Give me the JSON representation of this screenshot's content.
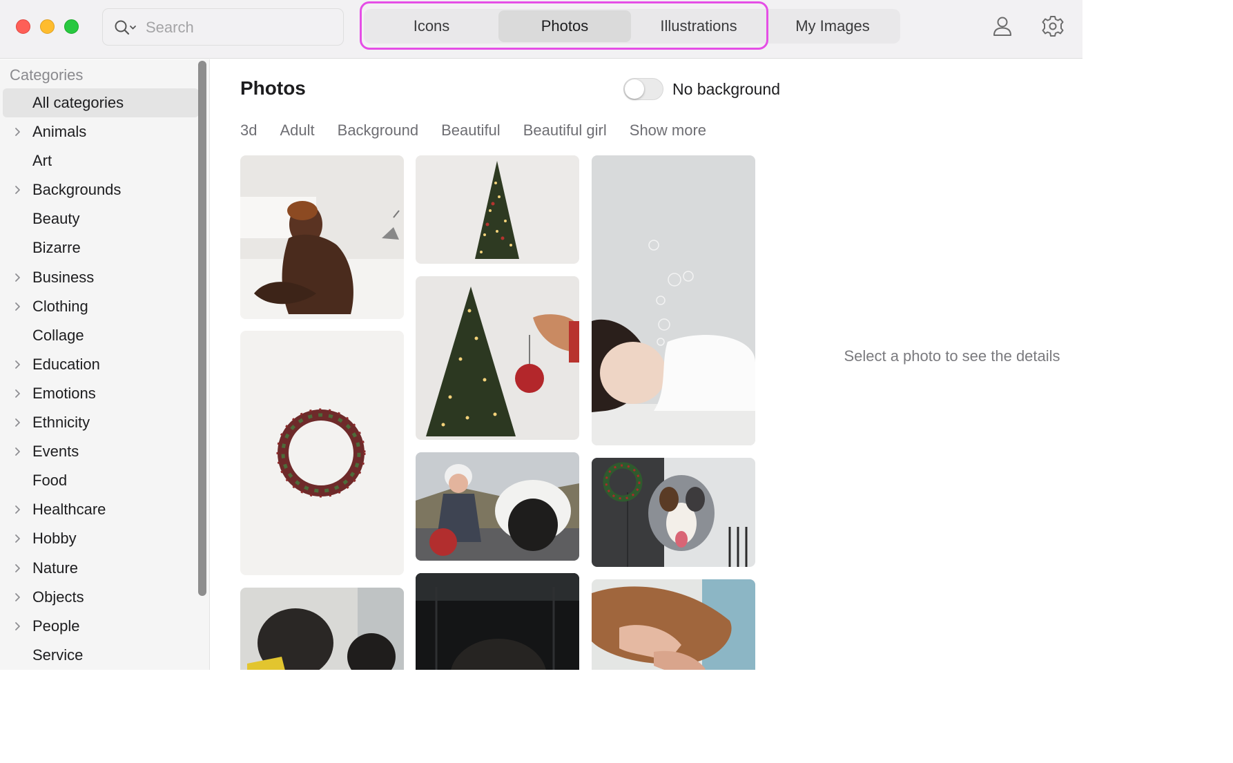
{
  "window": {
    "traffic_lights": [
      "close",
      "minimize",
      "zoom"
    ],
    "colors": {
      "close": "#fe5f57",
      "minimize": "#febc2e",
      "zoom": "#28c840",
      "highlight": "#e54ee6"
    }
  },
  "search": {
    "placeholder": "Search"
  },
  "tabs": [
    {
      "label": "Icons",
      "active": false
    },
    {
      "label": "Photos",
      "active": true
    },
    {
      "label": "Illustrations",
      "active": false
    },
    {
      "label": "My Images",
      "active": false
    }
  ],
  "toolbar_icons": [
    "person-icon",
    "gear-icon"
  ],
  "sidebar": {
    "title": "Categories",
    "items": [
      {
        "label": "All categories",
        "expandable": false,
        "selected": true
      },
      {
        "label": "Animals",
        "expandable": true
      },
      {
        "label": "Art",
        "expandable": false
      },
      {
        "label": "Backgrounds",
        "expandable": true
      },
      {
        "label": "Beauty",
        "expandable": false
      },
      {
        "label": "Bizarre",
        "expandable": false
      },
      {
        "label": "Business",
        "expandable": true
      },
      {
        "label": "Clothing",
        "expandable": true
      },
      {
        "label": "Collage",
        "expandable": false
      },
      {
        "label": "Education",
        "expandable": true
      },
      {
        "label": "Emotions",
        "expandable": true
      },
      {
        "label": "Ethnicity",
        "expandable": true
      },
      {
        "label": "Events",
        "expandable": true
      },
      {
        "label": "Food",
        "expandable": false
      },
      {
        "label": "Healthcare",
        "expandable": true
      },
      {
        "label": "Hobby",
        "expandable": true
      },
      {
        "label": "Nature",
        "expandable": true
      },
      {
        "label": "Objects",
        "expandable": true
      },
      {
        "label": "People",
        "expandable": true
      },
      {
        "label": "Service",
        "expandable": false
      }
    ]
  },
  "main": {
    "title": "Photos",
    "toggle": {
      "label": "No background",
      "on": false
    },
    "tags": [
      "3d",
      "Adult",
      "Background",
      "Beautiful",
      "Beautiful girl",
      "Show more"
    ],
    "photos": [
      "man-sitting-on-bed-photo",
      "christmas-tree-photo",
      "woman-sleeping-photo",
      "wreath-photo",
      "christmas-tree-ornament-photo",
      "woman-pug-scooter-photo",
      "dog-christmas-door-photo",
      "pugs-photo",
      "dark-pug-photo",
      "dog-massage-photo"
    ]
  },
  "details": {
    "message": "Select a photo to see the details"
  }
}
